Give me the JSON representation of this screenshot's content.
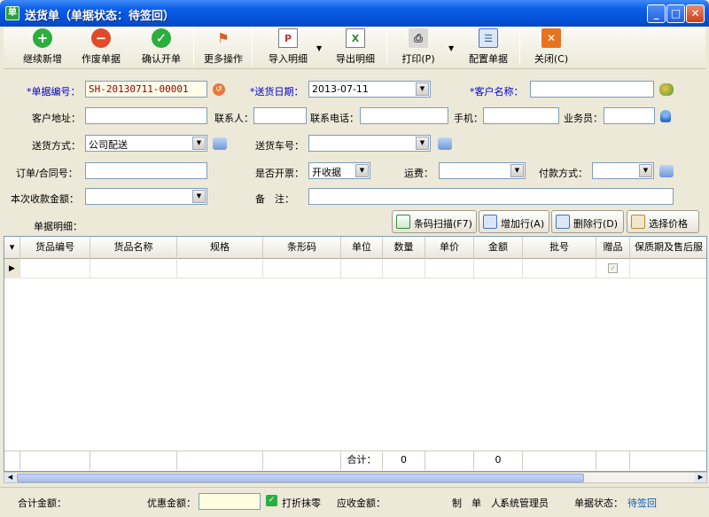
{
  "window": {
    "title": "送货单（单据状态：待签回）",
    "app_icon": "单"
  },
  "toolbar": {
    "buttons": [
      {
        "label": "继续新增",
        "icon": "plus-icon"
      },
      {
        "label": "作废单据",
        "icon": "minus-icon"
      },
      {
        "label": "确认开单",
        "icon": "check-icon"
      },
      {
        "label": "更多操作",
        "icon": "flag-icon"
      },
      {
        "label": "导入明细",
        "icon": "import-icon"
      },
      {
        "label": "导出明细",
        "icon": "export-icon"
      },
      {
        "label": "打印(P)",
        "icon": "printer-icon"
      },
      {
        "label": "配置单据",
        "icon": "config-icon"
      },
      {
        "label": "关闭(C)",
        "icon": "close-icon"
      }
    ]
  },
  "form": {
    "doc_no_label": "*单据编号：",
    "doc_no_value": "SH-20130711-00001",
    "ship_date_label": "*送货日期：",
    "ship_date_value": "2013-07-11",
    "customer_label": "*客户名称：",
    "customer_value": "",
    "address_label": "客户地址：",
    "contact_label": "联系人：",
    "phone_label": "联系电话：",
    "mobile_label": "手机：",
    "salesman_label": "业务员：",
    "ship_method_label": "送货方式：",
    "ship_method_value": "公司配送",
    "vehicle_label": "送货车号：",
    "order_no_label": "订单/合同号：",
    "invoice_label": "是否开票：",
    "invoice_value": "开收据",
    "freight_label": "运费：",
    "payment_label": "付款方式：",
    "receipt_label": "本次收款金额：",
    "remark_label": "备　注："
  },
  "detail": {
    "label": "单据明细：",
    "buttons": [
      {
        "label": "条码扫描(F7)",
        "icon": "barcode-scan-icon"
      },
      {
        "label": "增加行(A)",
        "icon": "add-row-icon"
      },
      {
        "label": "删除行(D)",
        "icon": "delete-row-icon"
      },
      {
        "label": "选择价格",
        "icon": "price-icon"
      }
    ],
    "columns": [
      "货品编号",
      "货品名称",
      "规格",
      "条形码",
      "单位",
      "数量",
      "单价",
      "金额",
      "批号",
      "赠品",
      "保质期及售后服"
    ],
    "totals": {
      "label": "合计：",
      "quantity": "0",
      "amount": "0"
    }
  },
  "status": {
    "total_label": "合计金额：",
    "discount_label": "优惠金额：",
    "round_label": "打折抹零",
    "receivable_label": "应收金额：",
    "maker_label": "制　单　人：",
    "maker_value": "系统管理员",
    "state_label": "单据状态：",
    "state_value": "待签回"
  }
}
